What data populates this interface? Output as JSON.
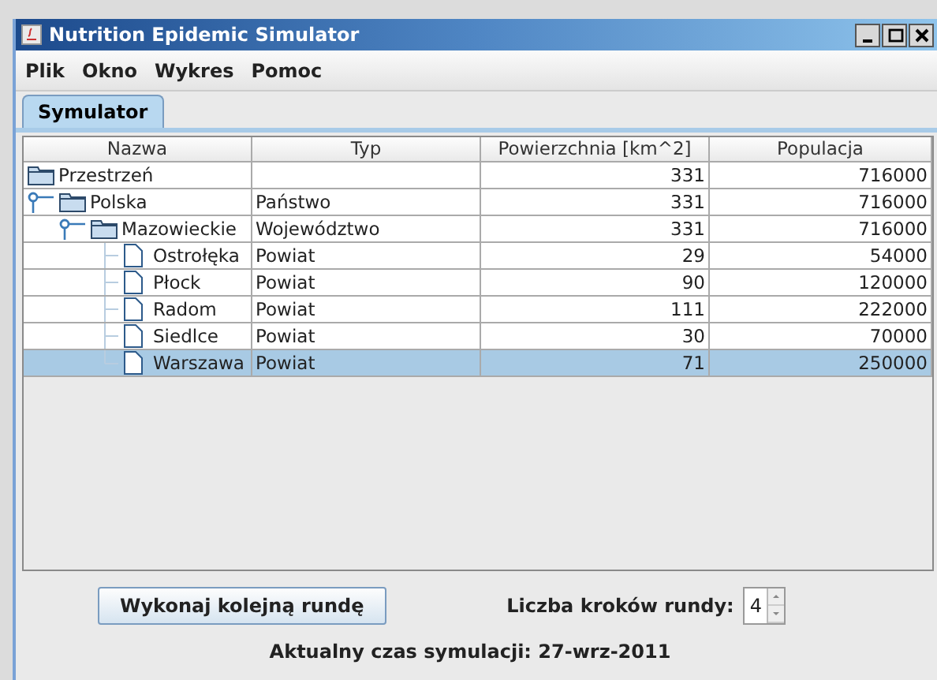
{
  "window": {
    "title": "Nutrition Epidemic Simulator"
  },
  "menu": [
    "Plik",
    "Okno",
    "Wykres",
    "Pomoc"
  ],
  "tabs": [
    {
      "label": "Symulator",
      "selected": true
    }
  ],
  "table": {
    "columns": [
      "Nazwa",
      "Typ",
      "Powierzchnia [km^2]",
      "Populacja"
    ],
    "rows": [
      {
        "kind": "folder",
        "name": "Przestrzeń",
        "type": "",
        "area": "331",
        "population": "716000",
        "selected": false,
        "children": [
          {
            "kind": "folder",
            "name": "Polska",
            "type": "Państwo",
            "area": "331",
            "population": "716000",
            "selected": false,
            "children": [
              {
                "kind": "folder",
                "name": "Mazowieckie",
                "type": "Województwo",
                "area": "331",
                "population": "716000",
                "selected": false,
                "children": [
                  {
                    "kind": "leaf",
                    "name": "Ostrołęka",
                    "type": "Powiat",
                    "area": "29",
                    "population": "54000",
                    "selected": false
                  },
                  {
                    "kind": "leaf",
                    "name": "Płock",
                    "type": "Powiat",
                    "area": "90",
                    "population": "120000",
                    "selected": false
                  },
                  {
                    "kind": "leaf",
                    "name": "Radom",
                    "type": "Powiat",
                    "area": "111",
                    "population": "222000",
                    "selected": false
                  },
                  {
                    "kind": "leaf",
                    "name": "Siedlce",
                    "type": "Powiat",
                    "area": "30",
                    "population": "70000",
                    "selected": false
                  },
                  {
                    "kind": "leaf",
                    "name": "Warszawa",
                    "type": "Powiat",
                    "area": "71",
                    "population": "250000",
                    "selected": true
                  }
                ]
              }
            ]
          }
        ]
      }
    ]
  },
  "run_button": "Wykonaj kolejną rundę",
  "steps": {
    "label": "Liczba kroków rundy:",
    "value": "4"
  },
  "status": "Aktualny czas symulacji: 27-wrz-2011"
}
